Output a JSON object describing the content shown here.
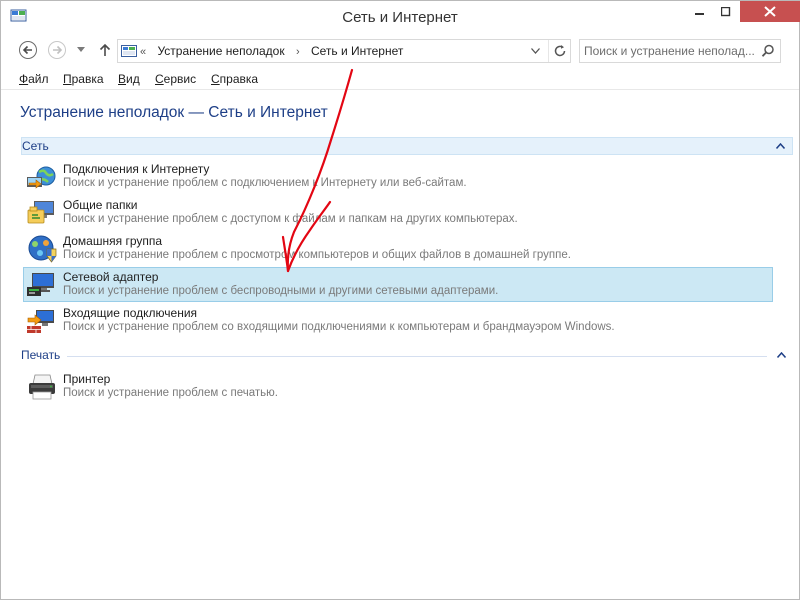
{
  "window": {
    "title": "Сеть и Интернет"
  },
  "address": {
    "crumbs": [
      "Устранение неполадок",
      "Сеть и Интернет"
    ],
    "overflow": "«",
    "search_placeholder": "Поиск и устранение неполад..."
  },
  "menu": {
    "items": [
      "Файл",
      "Правка",
      "Вид",
      "Сервис",
      "Справка"
    ]
  },
  "page": {
    "title": "Устранение неполадок — Сеть и Интернет"
  },
  "groups": [
    {
      "name": "Сеть",
      "items": [
        {
          "title": "Подключения к Интернету",
          "desc": "Поиск и устранение проблем с подключением к Интернету или веб-сайтам.",
          "icon": "internet-connections-icon"
        },
        {
          "title": "Общие папки",
          "desc": "Поиск и устранение проблем с доступом к файлам и папкам на других компьютерах.",
          "icon": "shared-folders-icon"
        },
        {
          "title": "Домашняя группа",
          "desc": "Поиск и устранение проблем с просмотром компьютеров и общих файлов в домашней группе.",
          "icon": "homegroup-icon"
        },
        {
          "title": "Сетевой адаптер",
          "desc": "Поиск и устранение проблем с беспроводными и другими сетевыми адаптерами.",
          "icon": "network-adapter-icon",
          "selected": true
        },
        {
          "title": "Входящие подключения",
          "desc": "Поиск и устранение проблем со входящими подключениями к компьютерам и брандмауэром Windows.",
          "icon": "incoming-connections-icon"
        }
      ]
    },
    {
      "name": "Печать",
      "items": [
        {
          "title": "Принтер",
          "desc": "Поиск и устранение проблем с печатью.",
          "icon": "printer-icon"
        }
      ]
    }
  ],
  "annotation": {
    "arrow_color": "#e30613"
  }
}
